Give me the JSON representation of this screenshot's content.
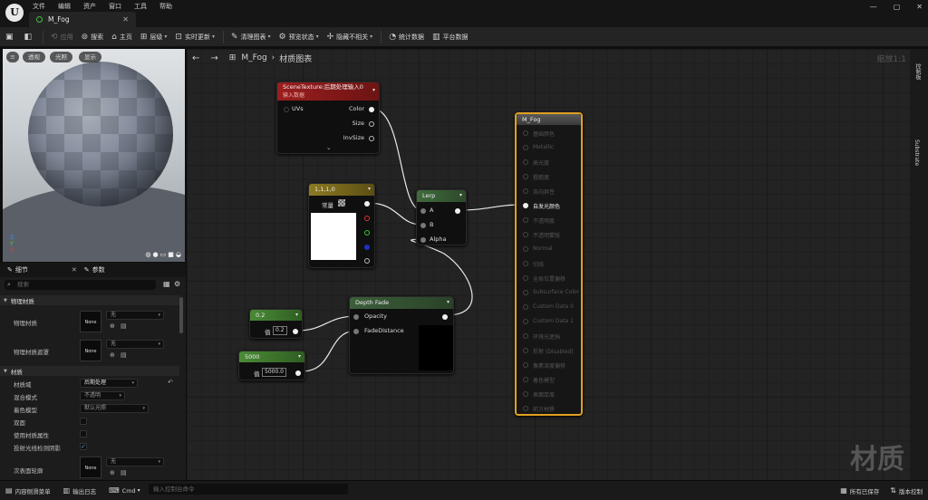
{
  "menu": [
    "文件",
    "编辑",
    "资产",
    "窗口",
    "工具",
    "帮助"
  ],
  "tab": {
    "name": "M_Fog"
  },
  "window_controls": {
    "min": "—",
    "max": "▢",
    "close": "✕"
  },
  "toolbar": {
    "save_icon": "💾",
    "browse_icon": "📂",
    "apply": "应用",
    "search": "搜索",
    "home": "主页",
    "hierarchy": "层级",
    "live_update": "实时更新",
    "clean_graph": "清理图表",
    "preview_state": "预览状态",
    "hide_unrelated": "隐藏不相关",
    "stats": "统计数据",
    "platform_stats": "平台数据"
  },
  "viewport": {
    "perspective": "透视",
    "lit": "光照",
    "show": "显示",
    "axis": {
      "x": "X",
      "y": "Y",
      "z": "Z"
    }
  },
  "details": {
    "tab_details": "细节",
    "tab_params": "参数",
    "search_placeholder": "搜索",
    "cat_physical": "物理材质",
    "phys_mat": "物理材质",
    "phys_mat_mask": "物理材质遮罩",
    "none": "None",
    "none_value": "无",
    "cat_material": "材质",
    "domain_label": "材质域",
    "domain_value": "后期处理",
    "blend_label": "混合模式",
    "blend_value": "不透明",
    "shading_label": "着色模型",
    "shading_value": "默认光照",
    "two_sided": "双面",
    "use_attr": "使用材质属性",
    "cast_ray": "投射光线检测阴影",
    "subsurface": "次表面轮廓"
  },
  "graph": {
    "breadcrumb_asset": "M_Fog",
    "breadcrumb_graph": "材质图表",
    "zoom": "缩放1:1",
    "watermark": "材质",
    "right_tab1": "控制板",
    "right_tab2": "Substrate"
  },
  "nodes": {
    "scene_texture": {
      "title": "SceneTexture:后期处理输入0",
      "subtitle": "输入数据",
      "uvs": "UVs",
      "color": "Color",
      "size": "Size",
      "invsize": "InvSize"
    },
    "constant": {
      "title": "1,1,1,0",
      "label": "常量"
    },
    "lerp": {
      "title": "Lerp",
      "a": "A",
      "b": "B",
      "alpha": "Alpha"
    },
    "depth_fade": {
      "title": "Depth Fade",
      "opacity": "Opacity",
      "fade": "FadeDistance"
    },
    "c02": {
      "title": "0.2",
      "val_label": "值",
      "value": "0.2"
    },
    "c5000": {
      "title": "5000",
      "val_label": "值",
      "value": "5000.0"
    },
    "mfog": {
      "title": "M_Fog",
      "inputs": [
        "基础颜色",
        "Metallic",
        "高光度",
        "粗糙度",
        "各向异性",
        "自发光颜色",
        "不透明度",
        "不透明蒙版",
        "Normal",
        "切线",
        "全局位置偏移",
        "Subsurface Color",
        "Custom Data 0",
        "Custom Data 1",
        "环境光遮挡",
        "折射 (Disabled)",
        "像素深度偏移",
        "着色模型",
        "表面厚度",
        "前方材质"
      ],
      "active_index": 5
    }
  },
  "status": {
    "content_drawer": "内容侧滑菜单",
    "output_log": "输出日志",
    "cmd": "Cmd",
    "cmd_placeholder": "输入控制台命令",
    "saved": "所有已保存",
    "source_control": "版本控制"
  },
  "colors": {
    "scene_header": "#8a1a1a",
    "const_header": "#7a6a20",
    "lerp_header": "#3a5a38",
    "depth_header": "#385536",
    "scalar_header": "#3a6e2e",
    "mfog_border": "#e0a020",
    "accent_blue": "#4aa3ff"
  }
}
